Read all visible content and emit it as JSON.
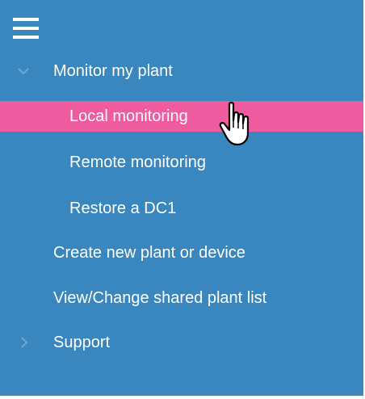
{
  "menu": {
    "toggle_icon": "hamburger-icon",
    "items": [
      {
        "label": "Monitor my plant",
        "icon": "chevron-down-icon"
      },
      {
        "label": "Local monitoring"
      },
      {
        "label": "Remote monitoring"
      },
      {
        "label": "Restore a DC1"
      },
      {
        "label": "Create new plant or device"
      },
      {
        "label": "View/Change shared plant list"
      },
      {
        "label": "Support",
        "icon": "chevron-right-icon"
      }
    ]
  },
  "colors": {
    "panel_background": "#3a87c0",
    "selected_background": "#ee5b9e",
    "text": "#ffffff",
    "chevron": "#6fa6d2"
  },
  "cursor_icon": "pointing-hand-cursor-icon"
}
